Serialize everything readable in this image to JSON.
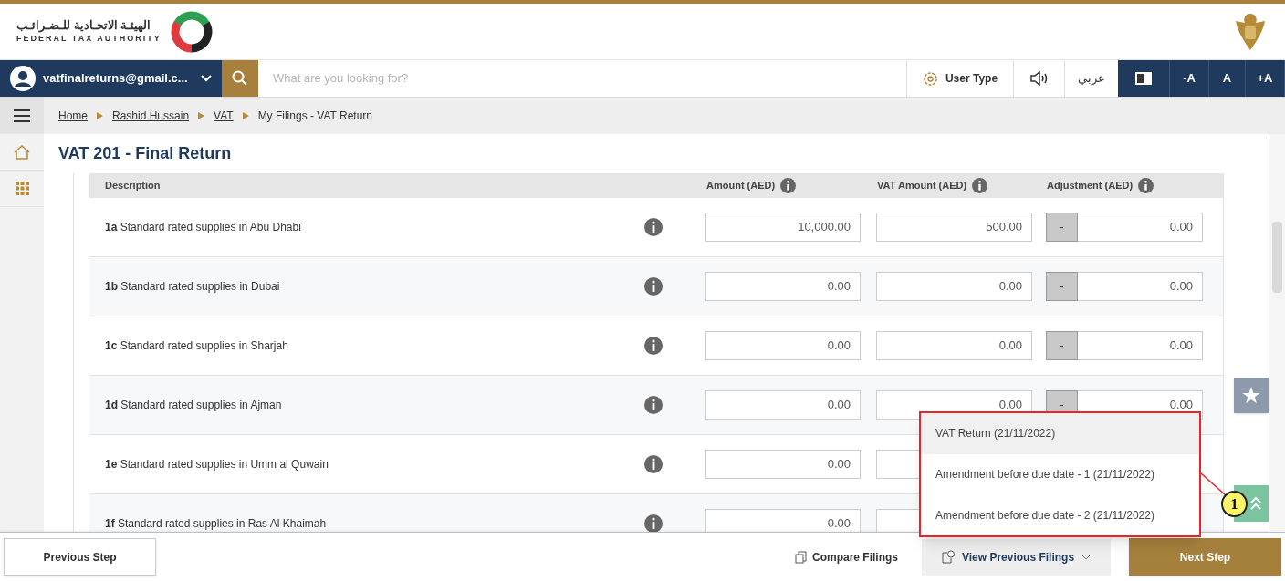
{
  "header": {
    "logo_arabic": "الهيئـة الاتحـادية للـضـرائـب",
    "logo_english": "FEDERAL TAX AUTHORITY"
  },
  "nav": {
    "user_email": "vatfinalreturns@gmail.c...",
    "search_placeholder": "What are you looking for?",
    "user_type": "User Type",
    "language": "عربي",
    "font_buttons": [
      "-A",
      "A",
      "+A"
    ]
  },
  "breadcrumb": [
    {
      "label": "Home",
      "link": true
    },
    {
      "label": "Rashid Hussain",
      "link": true
    },
    {
      "label": "VAT",
      "link": true
    },
    {
      "label": "My Filings - VAT Return",
      "link": false
    }
  ],
  "page_title": "VAT 201 - Final Return",
  "table": {
    "columns": [
      "Description",
      "Amount (AED)",
      "VAT Amount (AED)",
      "Adjustment (AED)"
    ],
    "rows": [
      {
        "code": "1a",
        "description": "Standard rated supplies in Abu Dhabi",
        "amount": "10,000.00",
        "vat_amount": "500.00",
        "adjustment_sign": "-",
        "adjustment": "0.00"
      },
      {
        "code": "1b",
        "description": "Standard rated supplies in Dubai",
        "amount": "0.00",
        "vat_amount": "0.00",
        "adjustment_sign": "-",
        "adjustment": "0.00"
      },
      {
        "code": "1c",
        "description": "Standard rated supplies in Sharjah",
        "amount": "0.00",
        "vat_amount": "0.00",
        "adjustment_sign": "-",
        "adjustment": "0.00"
      },
      {
        "code": "1d",
        "description": "Standard rated supplies in Ajman",
        "amount": "0.00",
        "vat_amount": "0.00",
        "adjustment_sign": "-",
        "adjustment": "0.00"
      },
      {
        "code": "1e",
        "description": "Standard rated supplies in Umm al Quwain",
        "amount": "0.00"
      },
      {
        "code": "1f",
        "description": "Standard rated supplies in Ras Al Khaimah",
        "amount": "0.00"
      }
    ]
  },
  "footer": {
    "previous": "Previous Step",
    "compare": "Compare Filings",
    "view_previous": "View Previous Filings",
    "next": "Next Step"
  },
  "previous_filings_menu": [
    {
      "label": "VAT Return (21/11/2022)",
      "selected": true
    },
    {
      "label": "Amendment before due date - 1 (21/11/2022)",
      "selected": false
    },
    {
      "label": "Amendment before due date - 2 (21/11/2022)",
      "selected": false
    }
  ],
  "annotation": {
    "label": "1"
  }
}
